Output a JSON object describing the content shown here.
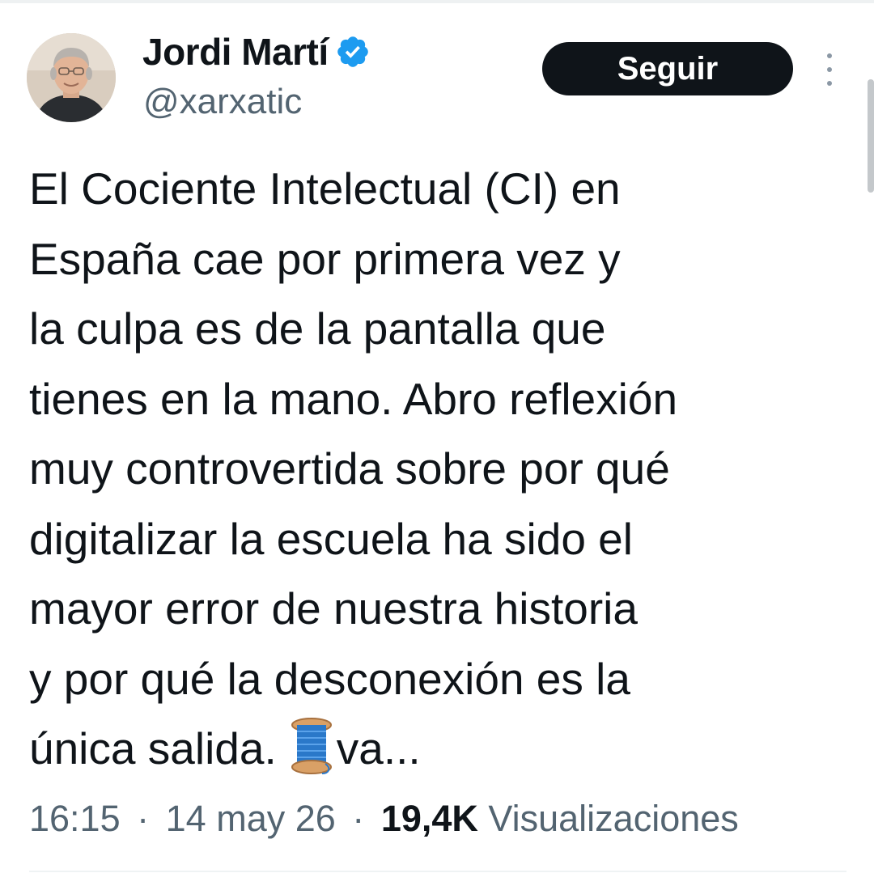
{
  "author": {
    "display_name": "Jordi Martí",
    "handle": "@xarxatic",
    "verified": true,
    "avatar_icon": "user-photo-avatar",
    "verified_icon": "verified-badge-icon",
    "verified_color": "#1d9bf0"
  },
  "actions": {
    "follow_label": "Seguir",
    "more_icon": "more-options-icon"
  },
  "tweet": {
    "lines": [
      "El Cociente Intelectual (CI) en",
      "España cae por primera vez y",
      "la culpa es de la pantalla que",
      "tienes en la mano. Abro reflexión",
      "muy controvertida sobre por qué",
      "digitalizar la escuela ha sido el",
      "mayor error de nuestra historia",
      "y por qué la desconexión es la",
      "única salida."
    ],
    "thread_emoji": "thread-spool-emoji",
    "trailing_text": "va..."
  },
  "meta": {
    "time": "16:15",
    "separator": "·",
    "date": "14 may 26",
    "views_count": "19,4K",
    "views_label": "Visualizaciones"
  },
  "colors": {
    "text": "#0f1419",
    "secondary": "#536471",
    "follow_bg": "#0f1419",
    "follow_text": "#ffffff"
  }
}
